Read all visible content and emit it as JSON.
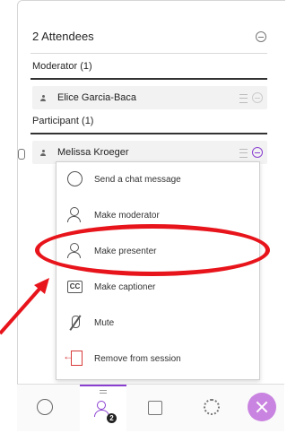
{
  "header": {
    "title": "2 Attendees"
  },
  "moderator_section": {
    "label": "Moderator (1)",
    "attendees": [
      {
        "name": "Elice Garcia-Baca"
      }
    ]
  },
  "participant_section": {
    "label": "Participant (1)",
    "attendees": [
      {
        "name": "Melissa Kroeger"
      }
    ]
  },
  "context_menu": {
    "items": [
      {
        "label": "Send a chat message",
        "icon": "chat-bubble-icon"
      },
      {
        "label": "Make moderator",
        "icon": "user-star-icon"
      },
      {
        "label": "Make presenter",
        "icon": "user-presenter-icon"
      },
      {
        "label": "Make captioner",
        "icon": "closed-caption-icon",
        "glyph": "CC"
      },
      {
        "label": "Mute",
        "icon": "mic-off-icon"
      },
      {
        "label": "Remove from session",
        "icon": "exit-icon"
      }
    ]
  },
  "tabbar": {
    "attendees_badge": "2",
    "tabs": [
      "chat",
      "attendees",
      "share-content",
      "settings",
      "close"
    ]
  },
  "colors": {
    "accent": "#8a3fd1",
    "highlight": "#e8141b",
    "close_button": "#c983e0"
  }
}
